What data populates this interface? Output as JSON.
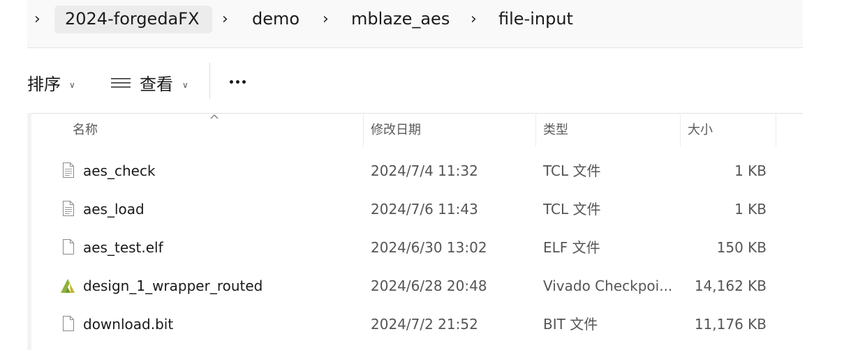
{
  "breadcrumb": {
    "items": [
      {
        "label": "2024-forgedaFX"
      },
      {
        "label": "demo"
      },
      {
        "label": "mblaze_aes"
      },
      {
        "label": "file-input"
      }
    ]
  },
  "toolbar": {
    "sort_label": "排序",
    "view_label": "查看"
  },
  "columns": {
    "name": "名称",
    "modified": "修改日期",
    "type": "类型",
    "size": "大小"
  },
  "files": [
    {
      "name": "aes_check",
      "modified": "2024/7/4 11:32",
      "type": "TCL 文件",
      "size": "1 KB",
      "icon": "text-file-icon"
    },
    {
      "name": "aes_load",
      "modified": "2024/7/6 11:43",
      "type": "TCL 文件",
      "size": "1 KB",
      "icon": "text-file-icon"
    },
    {
      "name": "aes_test.elf",
      "modified": "2024/6/30 13:02",
      "type": "ELF 文件",
      "size": "150 KB",
      "icon": "blank-file-icon"
    },
    {
      "name": "design_1_wrapper_routed",
      "modified": "2024/6/28 20:48",
      "type": "Vivado Checkpoi...",
      "size": "14,162 KB",
      "icon": "vivado-logo-icon"
    },
    {
      "name": "download.bit",
      "modified": "2024/7/2 21:52",
      "type": "BIT 文件",
      "size": "11,176 KB",
      "icon": "blank-file-icon"
    }
  ],
  "colors": {
    "breadcrumb_bg": "#f9f9f9",
    "crumb_highlight": "#ececec",
    "vivado_green": "#8fb33a",
    "vivado_yellow": "#c9b42c"
  }
}
